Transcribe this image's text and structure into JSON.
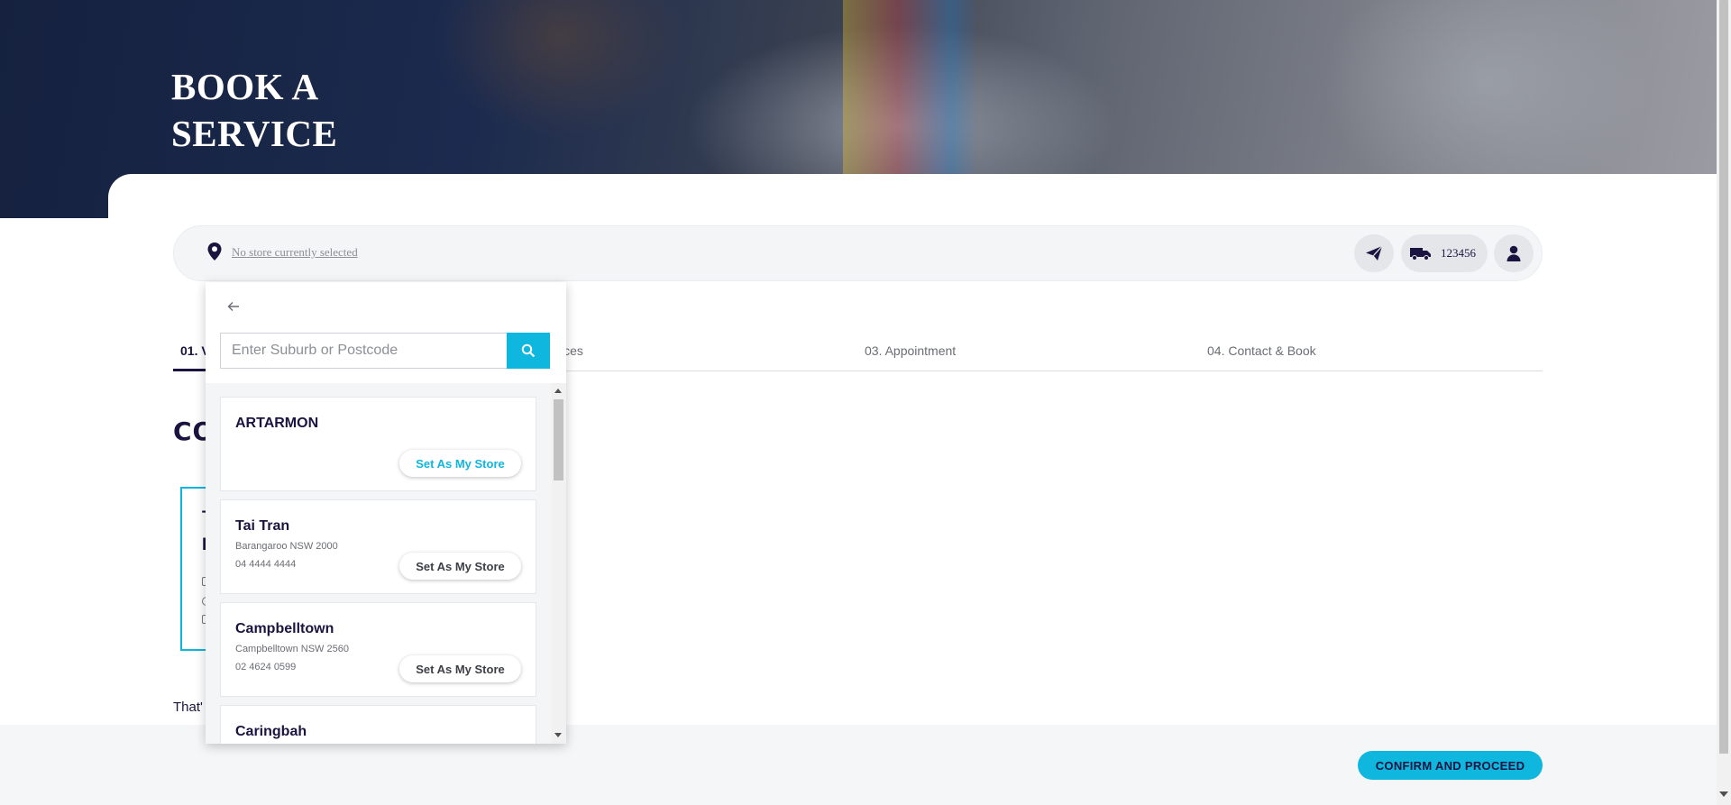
{
  "hero": {
    "title_line1": "BOOK A",
    "title_line2": "SERVICE"
  },
  "store_bar": {
    "store_text": "No store currently selected",
    "rego": "123456",
    "icons": [
      "location-pin-icon",
      "paper-plane-icon",
      "truck-icon",
      "user-icon"
    ]
  },
  "steps": [
    {
      "label": "01. V"
    },
    {
      "label": "ices"
    },
    {
      "label": "03. Appointment"
    },
    {
      "label": "04. Contact & Book"
    }
  ],
  "main": {
    "section_heading": "CO",
    "vehicle_card": {
      "line1": "T",
      "line2": "L"
    },
    "thats_text": "That'"
  },
  "footer": {
    "confirm_label": "CONFIRM AND PROCEED"
  },
  "dropdown": {
    "search_placeholder": "Enter Suburb or Postcode",
    "stores": [
      {
        "name": "ARTARMON",
        "address": "",
        "phone": "",
        "button": "Set As My Store"
      },
      {
        "name": "Tai Tran",
        "address": "Barangaroo NSW 2000",
        "phone": "04 4444 4444",
        "button": "Set As My Store"
      },
      {
        "name": "Campbelltown",
        "address": "Campbelltown NSW 2560",
        "phone": "02 4624 0599",
        "button": "Set As My Store"
      },
      {
        "name": "Caringbah",
        "address": "",
        "phone": "",
        "button": ""
      }
    ]
  },
  "colors": {
    "accent": "#0fb6dd",
    "navy": "#1b1440",
    "muted": "#8d8f96"
  }
}
